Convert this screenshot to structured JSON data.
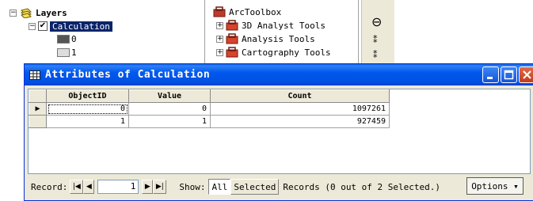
{
  "toc": {
    "layers_label": "Layers",
    "layer_name": "Calculation",
    "layer_checked": true,
    "legend": [
      {
        "label": "0",
        "color": "#555555"
      },
      {
        "label": "1",
        "color": "#dddddd"
      }
    ],
    "expand_glyph": "−"
  },
  "toolbox": {
    "title": "ArcToolbox",
    "items": [
      {
        "label": "3D Analyst Tools"
      },
      {
        "label": "Analysis Tools"
      },
      {
        "label": "Cartography Tools"
      }
    ],
    "expand_glyph": "+"
  },
  "tools": {
    "zoom_out_glyph": "⊖",
    "fixed_zoom_in_glyph": "⁑",
    "fixed_zoom_out_glyph": "⁑"
  },
  "window": {
    "title": "Attributes of Calculation",
    "titlebar_color": "#0054e3",
    "columns": [
      "ObjectID",
      "Value",
      "Count"
    ],
    "rows": [
      {
        "selector": "▶",
        "objectid": "0",
        "value": "0",
        "count": "1097261"
      },
      {
        "selector": "",
        "objectid": "1",
        "value": "1",
        "count": "927459"
      }
    ],
    "status": {
      "record_label": "Record:",
      "first_glyph": "|◀",
      "prev_glyph": "◀",
      "record_value": "1",
      "next_glyph": "▶",
      "last_glyph": "▶|",
      "show_label": "Show:",
      "all_label": "All",
      "selected_label": "Selected",
      "records_text": "Records (0 out of 2 Selected.)",
      "options_label": "Options ▾"
    }
  }
}
